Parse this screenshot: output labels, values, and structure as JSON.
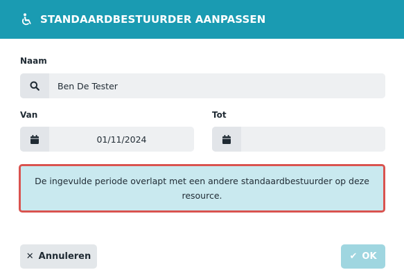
{
  "dialog": {
    "title": "STANDAARDBESTUURDER AANPASSEN",
    "title_icon": "wheelchair-icon",
    "header_color": "#1a9bb2"
  },
  "form": {
    "name_label": "Naam",
    "name_value": "Ben De Tester",
    "name_icon": "search-icon",
    "from_label": "Van",
    "from_value": "01/11/2024",
    "from_icon": "calendar-icon",
    "to_label": "Tot",
    "to_value": "",
    "to_icon": "calendar-icon"
  },
  "alert": {
    "message": "De ingevulde periode overlapt met een andere standaardbestuurder op deze resource.",
    "border_color": "#d9534f",
    "background_color": "#c9e9ef"
  },
  "footer": {
    "cancel_icon": "close-icon",
    "cancel_label": "Annuleren",
    "ok_icon": "check-icon",
    "ok_label": "OK"
  }
}
